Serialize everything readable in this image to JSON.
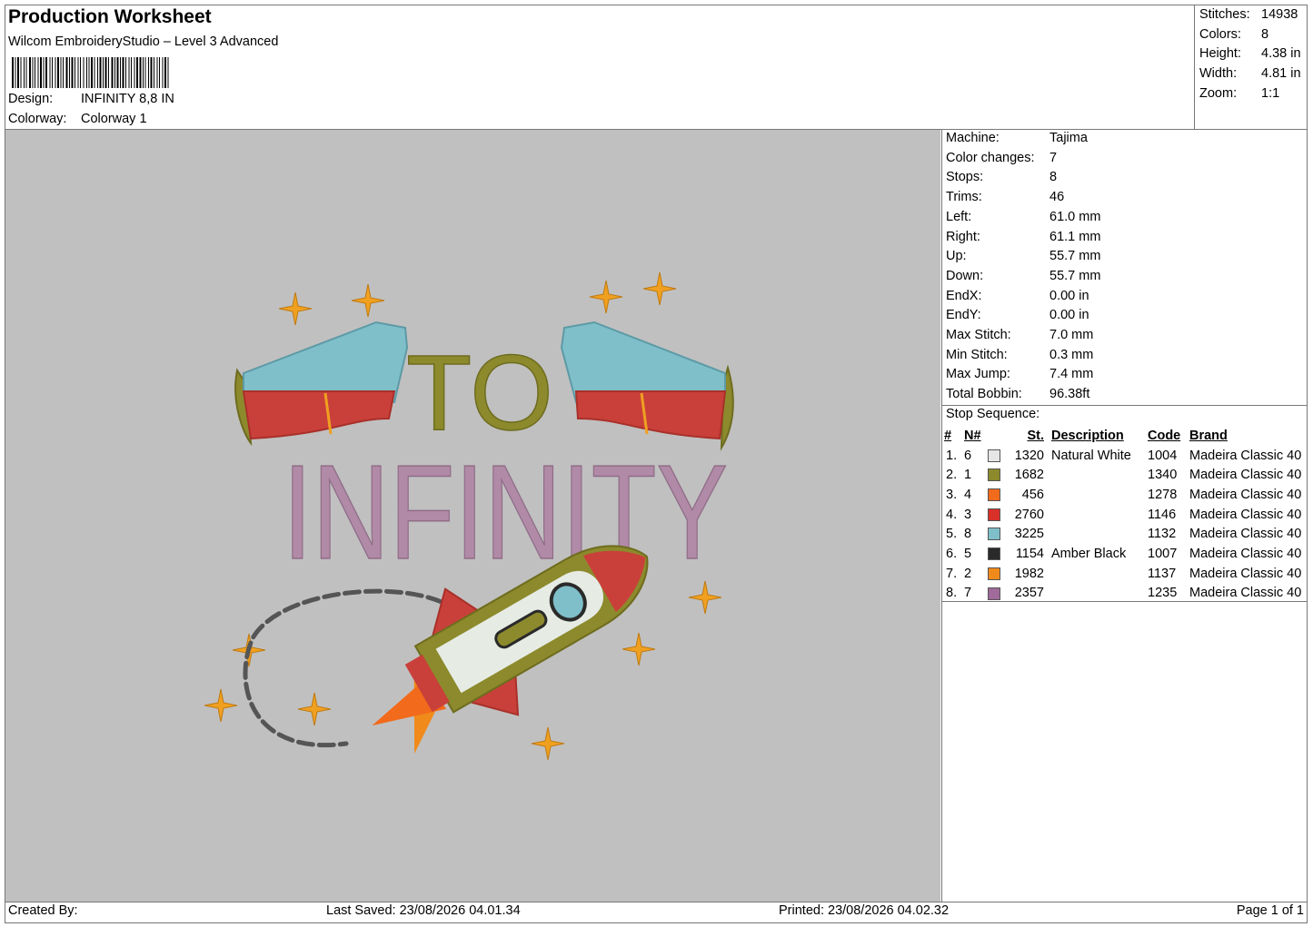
{
  "header": {
    "title": "Production Worksheet",
    "software": "Wilcom EmbroideryStudio – Level 3 Advanced",
    "design_label": "Design:",
    "design_value": "INFINITY 8,8 IN",
    "colorway_label": "Colorway:",
    "colorway_value": "Colorway 1"
  },
  "stats": {
    "stitches_label": "Stitches:",
    "stitches": "14938",
    "colors_label": "Colors:",
    "colors": "8",
    "height_label": "Height:",
    "height": "4.38 in",
    "width_label": "Width:",
    "width": "4.81 in",
    "zoom_label": "Zoom:",
    "zoom": "1:1"
  },
  "design_text": {
    "line1": "TO",
    "line2": "INFINITY"
  },
  "machine_info": [
    {
      "label": "Machine:",
      "value": "Tajima"
    },
    {
      "label": "Color changes:",
      "value": "7"
    },
    {
      "label": "Stops:",
      "value": "8"
    },
    {
      "label": "Trims:",
      "value": "46"
    },
    {
      "label": "Left:",
      "value": "61.0 mm"
    },
    {
      "label": "Right:",
      "value": "61.1 mm"
    },
    {
      "label": "Up:",
      "value": "55.7 mm"
    },
    {
      "label": "Down:",
      "value": "55.7 mm"
    },
    {
      "label": "EndX:",
      "value": "0.00 in"
    },
    {
      "label": "EndY:",
      "value": "0.00 in"
    },
    {
      "label": "Max Stitch:",
      "value": "7.0 mm"
    },
    {
      "label": "Min Stitch:",
      "value": "0.3 mm"
    },
    {
      "label": "Max Jump:",
      "value": "7.4 mm"
    },
    {
      "label": "Total Bobbin:",
      "value": "96.38ft"
    }
  ],
  "stop_sequence": {
    "heading": "Stop Sequence:",
    "columns": [
      "#",
      "N#",
      "St.",
      "Description",
      "Code",
      "Brand"
    ],
    "rows": [
      {
        "idx": "1.",
        "n": "6",
        "color": "#e6e6e6",
        "st": "1320",
        "desc": "Natural White",
        "code": "1004",
        "brand": "Madeira Classic 40"
      },
      {
        "idx": "2.",
        "n": "1",
        "color": "#8c8a2c",
        "st": "1682",
        "desc": "",
        "code": "1340",
        "brand": "Madeira Classic 40"
      },
      {
        "idx": "3.",
        "n": "4",
        "color": "#f26a1b",
        "st": "456",
        "desc": "",
        "code": "1278",
        "brand": "Madeira Classic 40"
      },
      {
        "idx": "4.",
        "n": "3",
        "color": "#d9302a",
        "st": "2760",
        "desc": "",
        "code": "1146",
        "brand": "Madeira Classic 40"
      },
      {
        "idx": "5.",
        "n": "8",
        "color": "#7fbfca",
        "st": "3225",
        "desc": "",
        "code": "1132",
        "brand": "Madeira Classic 40"
      },
      {
        "idx": "6.",
        "n": "5",
        "color": "#2a2a2a",
        "st": "1154",
        "desc": "Amber Black",
        "code": "1007",
        "brand": "Madeira Classic 40"
      },
      {
        "idx": "7.",
        "n": "2",
        "color": "#f08a1a",
        "st": "1982",
        "desc": "",
        "code": "1137",
        "brand": "Madeira Classic 40"
      },
      {
        "idx": "8.",
        "n": "7",
        "color": "#a06a9a",
        "st": "2357",
        "desc": "",
        "code": "1235",
        "brand": "Madeira Classic 40"
      }
    ]
  },
  "footer": {
    "created_by": "Created By:",
    "last_saved": "Last Saved: 23/08/2026 04.01.34",
    "printed": "Printed: 23/08/2026 04.02.32",
    "page": "Page 1 of 1"
  },
  "colors": {
    "canvas_bg": "#c0c0c0",
    "olive": "#8c8a2c",
    "mauve": "#b08aa6",
    "red": "#c9403a",
    "teal": "#7fbfca",
    "gold": "#f0a020"
  }
}
